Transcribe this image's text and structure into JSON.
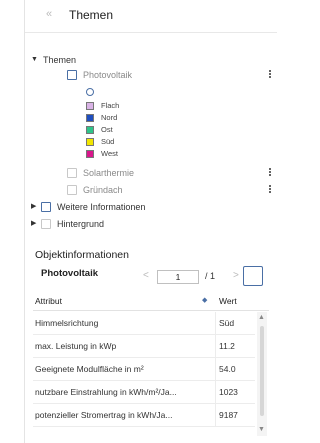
{
  "header": {
    "title": "Themen",
    "close_icon": "«"
  },
  "tree": {
    "root_label": "Themen",
    "photovoltaik_label": "Photovoltaik",
    "legend": [
      {
        "label": "Flach",
        "color": "#d9b3e6"
      },
      {
        "label": "Nord",
        "color": "#1f4fbf"
      },
      {
        "label": "Ost",
        "color": "#2fc48a"
      },
      {
        "label": "Süd",
        "color": "#f2e600"
      },
      {
        "label": "West",
        "color": "#d9168c"
      }
    ],
    "solarthermie_label": "Solarthermie",
    "gruendach_label": "Gründach",
    "weitere_label": "Weitere Informationen",
    "hintergrund_label": "Hintergrund"
  },
  "objektinfo": {
    "title": "Objektinformationen",
    "layer": "Photovoltaik",
    "page_current": "1",
    "page_of": "/ 1",
    "prev": "<",
    "next": ">",
    "col_attr": "Attribut",
    "col_val": "Wert",
    "rows": [
      {
        "attr": "Himmelsrichtung",
        "val": "Süd"
      },
      {
        "attr": "max. Leistung in kWp",
        "val": "11.2"
      },
      {
        "attr": "Geeignete Modulfläche in m²",
        "val": "54.0"
      },
      {
        "attr": "nutzbare Einstrahlung in kWh/m²/Ja...",
        "val": "1023"
      },
      {
        "attr": "potenzieller Stromertrag in kWh/Ja...",
        "val": "9187"
      }
    ]
  }
}
